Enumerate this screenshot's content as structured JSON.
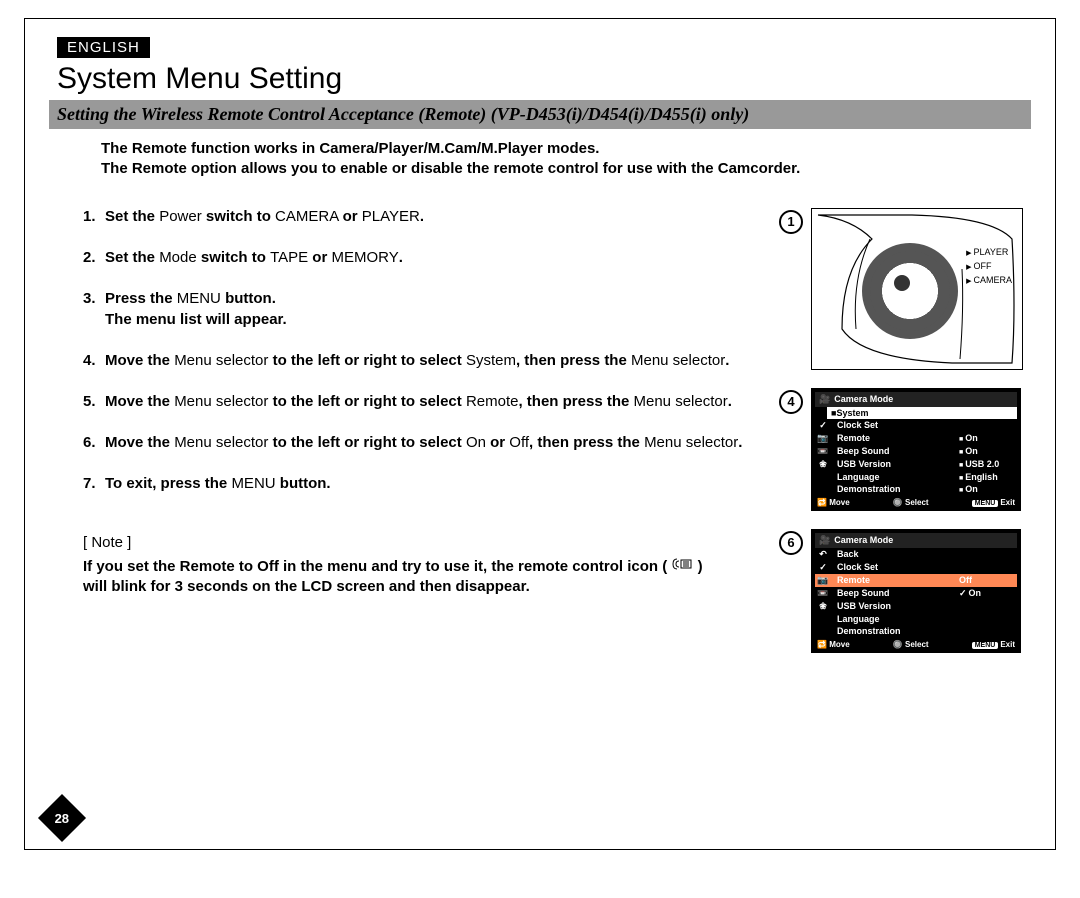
{
  "language_tag": "ENGLISH",
  "page_title": "System Menu Setting",
  "subtitle": "Setting the Wireless Remote Control Acceptance (Remote) (VP-D453(i)/D454(i)/D455(i) only)",
  "intro_lines": [
    "The Remote function works in Camera/Player/M.Cam/M.Player modes.",
    "The Remote option allows you to enable or disable the remote control for use with the Camcorder."
  ],
  "steps": [
    {
      "num": "1.",
      "parts": [
        {
          "b": true,
          "t": "Set the "
        },
        {
          "b": false,
          "t": "Power "
        },
        {
          "b": true,
          "t": "switch to "
        },
        {
          "b": false,
          "t": "CAMERA "
        },
        {
          "b": true,
          "t": "or "
        },
        {
          "b": false,
          "t": "PLAYER"
        },
        {
          "b": true,
          "t": "."
        }
      ]
    },
    {
      "num": "2.",
      "parts": [
        {
          "b": true,
          "t": "Set the "
        },
        {
          "b": false,
          "t": "Mode "
        },
        {
          "b": true,
          "t": "switch to "
        },
        {
          "b": false,
          "t": "TAPE "
        },
        {
          "b": true,
          "t": "or "
        },
        {
          "b": false,
          "t": "MEMORY"
        },
        {
          "b": true,
          "t": "."
        }
      ]
    },
    {
      "num": "3.",
      "parts": [
        {
          "b": true,
          "t": "Press the "
        },
        {
          "b": false,
          "t": "MENU "
        },
        {
          "b": true,
          "t": "button."
        }
      ],
      "extra": "The menu list will appear."
    },
    {
      "num": "4.",
      "parts": [
        {
          "b": true,
          "t": "Move the "
        },
        {
          "b": false,
          "t": "Menu selector "
        },
        {
          "b": true,
          "t": "to the left or right to select "
        },
        {
          "b": false,
          "t": "System"
        },
        {
          "b": true,
          "t": ", then press the "
        },
        {
          "b": false,
          "t": "Menu selector"
        },
        {
          "b": true,
          "t": "."
        }
      ]
    },
    {
      "num": "5.",
      "parts": [
        {
          "b": true,
          "t": "Move the "
        },
        {
          "b": false,
          "t": "Menu selector "
        },
        {
          "b": true,
          "t": "to the left or right to select "
        },
        {
          "b": false,
          "t": "Remote"
        },
        {
          "b": true,
          "t": ", then press the "
        },
        {
          "b": false,
          "t": "Menu selector"
        },
        {
          "b": true,
          "t": "."
        }
      ]
    },
    {
      "num": "6.",
      "parts": [
        {
          "b": true,
          "t": "Move the "
        },
        {
          "b": false,
          "t": "Menu selector "
        },
        {
          "b": true,
          "t": "to the left or right to select "
        },
        {
          "b": false,
          "t": "On "
        },
        {
          "b": true,
          "t": "or "
        },
        {
          "b": false,
          "t": "Off"
        },
        {
          "b": true,
          "t": ", then press the "
        },
        {
          "b": false,
          "t": "Menu selector"
        },
        {
          "b": true,
          "t": "."
        }
      ]
    },
    {
      "num": "7.",
      "parts": [
        {
          "b": true,
          "t": "To exit, press the "
        },
        {
          "b": false,
          "t": "MENU "
        },
        {
          "b": true,
          "t": "button."
        }
      ]
    }
  ],
  "note_label": "[ Note ]",
  "note_line1": "If you set the Remote to Off in the menu and try to use it, the remote control icon (",
  "note_line2": ")",
  "note_line3": "will blink for 3 seconds on the LCD screen and then disappear.",
  "fig1": {
    "num": "1",
    "dial_labels": [
      "PLAYER",
      "OFF",
      "CAMERA"
    ]
  },
  "fig4": {
    "num": "4",
    "title": "Camera Mode",
    "section": "System",
    "rows": [
      {
        "icon": "✓",
        "label": "Clock Set",
        "val": ""
      },
      {
        "icon": "📷",
        "label": "Remote",
        "val": "On",
        "sq": true
      },
      {
        "icon": "📼",
        "label": "Beep Sound",
        "val": "On",
        "sq": true
      },
      {
        "icon": "❀",
        "label": "USB Version",
        "val": "USB 2.0",
        "sq": true
      },
      {
        "icon": "",
        "label": "Language",
        "val": "English",
        "sq": true
      },
      {
        "icon": "",
        "label": "Demonstration",
        "val": "On",
        "sq": true
      }
    ],
    "foot": {
      "move": "Move",
      "select": "Select",
      "exit": "Exit",
      "exit_btn": "MENU"
    }
  },
  "fig6": {
    "num": "6",
    "title": "Camera Mode",
    "back": "Back",
    "rows": [
      {
        "icon": "✓",
        "label": "Clock Set",
        "val": ""
      },
      {
        "icon": "📷",
        "label": "Remote",
        "val": "Off",
        "hl": true
      },
      {
        "icon": "📼",
        "label": "Beep Sound",
        "val": "On",
        "sel": true
      },
      {
        "icon": "❀",
        "label": "USB Version",
        "val": ""
      },
      {
        "icon": "",
        "label": "Language",
        "val": ""
      },
      {
        "icon": "",
        "label": "Demonstration",
        "val": ""
      }
    ],
    "foot": {
      "move": "Move",
      "select": "Select",
      "exit": "Exit",
      "exit_btn": "MENU"
    }
  },
  "page_number": "28"
}
